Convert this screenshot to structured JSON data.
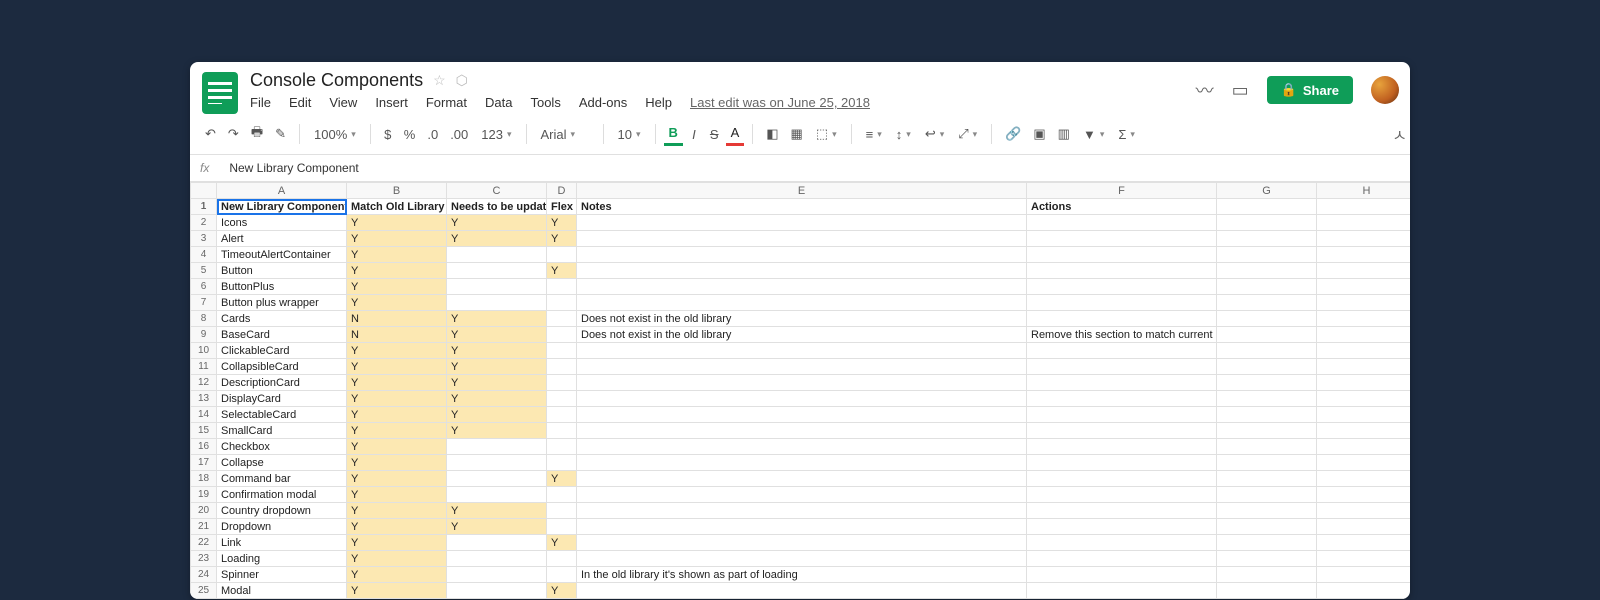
{
  "doc": {
    "title": "Console Components",
    "last_edit": "Last edit was on June 25, 2018"
  },
  "menus": [
    "File",
    "Edit",
    "View",
    "Insert",
    "Format",
    "Data",
    "Tools",
    "Add-ons",
    "Help"
  ],
  "share": "Share",
  "zoom": "100%",
  "font": "Arial",
  "font_size": "10",
  "formula": "New Library Component",
  "col_letters": [
    "A",
    "B",
    "C",
    "D",
    "E",
    "F",
    "G",
    "H"
  ],
  "headers": [
    "New Library Component",
    "Match Old Library",
    "Needs to be updated",
    "Flex",
    "Notes",
    "Actions",
    "",
    ""
  ],
  "rows": [
    {
      "n": 2,
      "a": "Icons",
      "b": "Y",
      "c": "Y",
      "d": "Y",
      "e": "",
      "f": ""
    },
    {
      "n": 3,
      "a": "Alert",
      "b": "Y",
      "c": "Y",
      "d": "Y",
      "e": "",
      "f": ""
    },
    {
      "n": 4,
      "a": "  TimeoutAlertContainer",
      "b": "Y",
      "c": "",
      "d": "",
      "e": "",
      "f": ""
    },
    {
      "n": 5,
      "a": "Button",
      "b": "Y",
      "c": "",
      "d": "Y",
      "e": "",
      "f": ""
    },
    {
      "n": 6,
      "a": "  ButtonPlus",
      "b": "Y",
      "c": "",
      "d": "",
      "e": "",
      "f": ""
    },
    {
      "n": 7,
      "a": "Button plus wrapper",
      "b": "Y",
      "c": "",
      "d": "",
      "e": "",
      "f": ""
    },
    {
      "n": 8,
      "a": "Cards",
      "b": "N",
      "c": "Y",
      "d": "",
      "e": "Does not exist in the old library",
      "f": ""
    },
    {
      "n": 9,
      "a": "  BaseCard",
      "b": "N",
      "c": "Y",
      "d": "",
      "e": "Does not exist in the old library",
      "f": "Remove this section to match current library"
    },
    {
      "n": 10,
      "a": "  ClickableCard",
      "b": "Y",
      "c": "Y",
      "d": "",
      "e": "",
      "f": ""
    },
    {
      "n": 11,
      "a": "  CollapsibleCard",
      "b": "Y",
      "c": "Y",
      "d": "",
      "e": "",
      "f": ""
    },
    {
      "n": 12,
      "a": "  DescriptionCard",
      "b": "Y",
      "c": "Y",
      "d": "",
      "e": "",
      "f": ""
    },
    {
      "n": 13,
      "a": "  DisplayCard",
      "b": "Y",
      "c": "Y",
      "d": "",
      "e": "",
      "f": ""
    },
    {
      "n": 14,
      "a": "  SelectableCard",
      "b": "Y",
      "c": "Y",
      "d": "",
      "e": "",
      "f": ""
    },
    {
      "n": 15,
      "a": "  SmallCard",
      "b": "Y",
      "c": "Y",
      "d": "",
      "e": "",
      "f": ""
    },
    {
      "n": 16,
      "a": "Checkbox",
      "b": "Y",
      "c": "",
      "d": "",
      "e": "",
      "f": ""
    },
    {
      "n": 17,
      "a": "Collapse",
      "b": "Y",
      "c": "",
      "d": "",
      "e": "",
      "f": ""
    },
    {
      "n": 18,
      "a": "Command bar",
      "b": "Y",
      "c": "",
      "d": "Y",
      "e": "",
      "f": ""
    },
    {
      "n": 19,
      "a": "Confirmation modal",
      "b": "Y",
      "c": "",
      "d": "",
      "e": "",
      "f": ""
    },
    {
      "n": 20,
      "a": "Country dropdown",
      "b": "Y",
      "c": "Y",
      "d": "",
      "e": "",
      "f": ""
    },
    {
      "n": 21,
      "a": "Dropdown",
      "b": "Y",
      "c": "Y",
      "d": "",
      "e": "",
      "f": ""
    },
    {
      "n": 22,
      "a": "Link",
      "b": "Y",
      "c": "",
      "d": "Y",
      "e": "",
      "f": ""
    },
    {
      "n": 23,
      "a": "Loading",
      "b": "Y",
      "c": "",
      "d": "",
      "e": "",
      "f": ""
    },
    {
      "n": 24,
      "a": "Spinner",
      "b": "Y",
      "c": "",
      "d": "",
      "e": "In the old library it's shown as part of loading",
      "f": ""
    },
    {
      "n": 25,
      "a": "Modal",
      "b": "Y",
      "c": "",
      "d": "Y",
      "e": "",
      "f": ""
    }
  ]
}
